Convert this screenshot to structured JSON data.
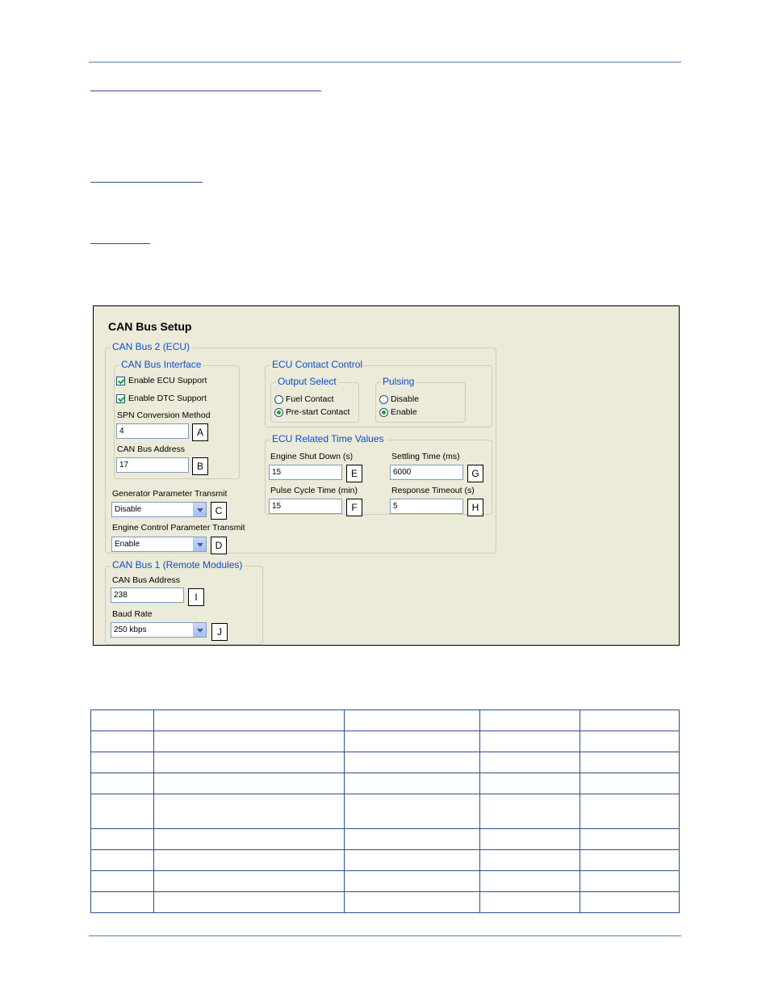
{
  "window": {
    "title": "CAN Bus Setup"
  },
  "can_bus_2": {
    "legend": "CAN Bus 2 (ECU)",
    "interface": {
      "legend": "CAN Bus Interface",
      "enable_ecu_support": "Enable ECU Support",
      "enable_dtc_support": "Enable DTC Support",
      "spn_label": "SPN Conversion Method",
      "spn_value": "4",
      "address_label": "CAN Bus Address",
      "address_value": "17"
    },
    "gen_param_label": "Generator Parameter Transmit",
    "gen_param_value": "Disable",
    "eng_ctrl_label": "Engine Control Parameter Transmit",
    "eng_ctrl_value": "Enable",
    "contact_control": {
      "legend": "ECU Contact Control",
      "output_select": {
        "legend": "Output Select",
        "fuel": "Fuel Contact",
        "prestart": "Pre-start Contact"
      },
      "pulsing": {
        "legend": "Pulsing",
        "disable": "Disable",
        "enable": "Enable"
      }
    },
    "time_values": {
      "legend": "ECU Related Time Values",
      "shutdown_label": "Engine Shut Down (s)",
      "shutdown_value": "15",
      "settling_label": "Settling Time (ms)",
      "settling_value": "6000",
      "pulse_label": "Pulse Cycle Time (min)",
      "pulse_value": "15",
      "response_label": "Response Timeout (s)",
      "response_value": "5"
    }
  },
  "can_bus_1": {
    "legend": "CAN Bus 1 (Remote Modules)",
    "address_label": "CAN Bus Address",
    "address_value": "238",
    "baud_label": "Baud Rate",
    "baud_value": "250 kbps"
  },
  "callouts": [
    "A",
    "B",
    "C",
    "D",
    "E",
    "F",
    "G",
    "H",
    "I",
    "J"
  ],
  "colors": {
    "legend_blue": "#0d4fc9",
    "panel_bg": "#ecead8",
    "rule": "#9fb7d3"
  }
}
